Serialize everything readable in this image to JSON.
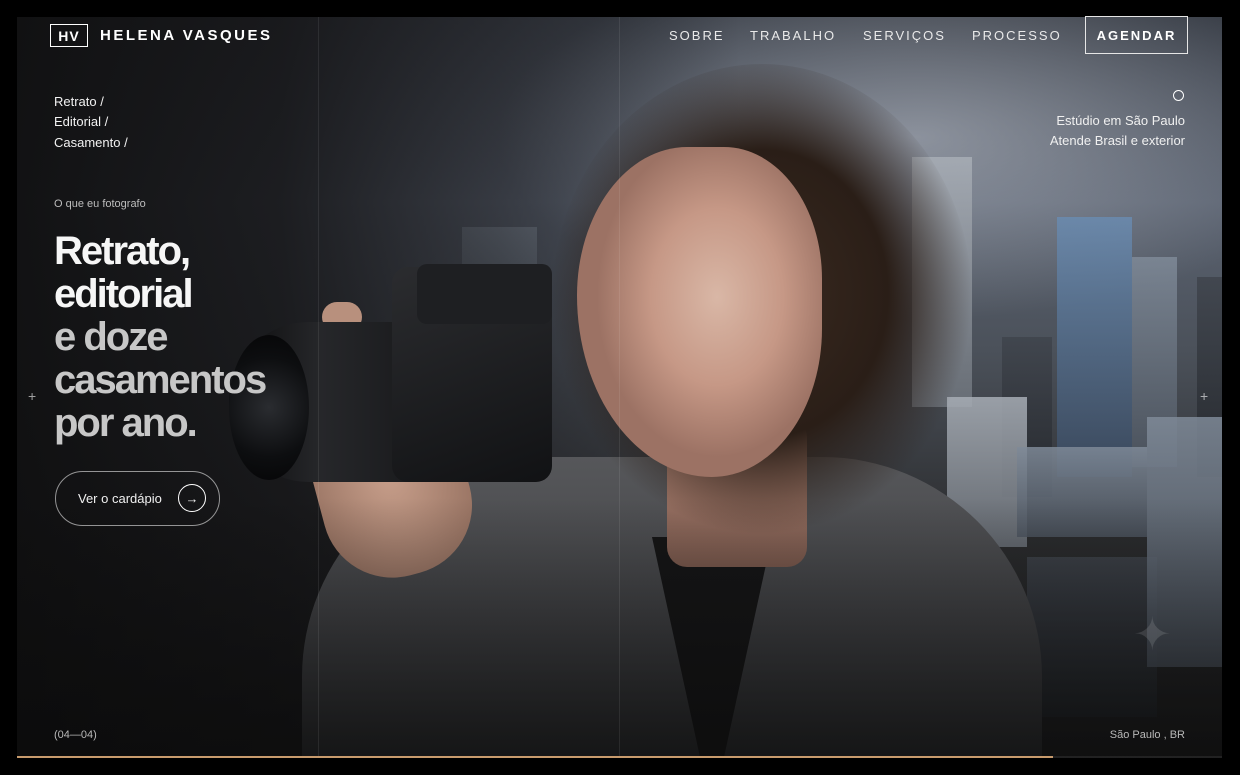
{
  "brand": {
    "logo_mark": "HV",
    "name": "HELENA VASQUES"
  },
  "nav": {
    "links": [
      "SOBRE",
      "TRABALHO",
      "SERVIÇOS",
      "PROCESSO"
    ],
    "cta": "AGENDAR"
  },
  "breadcrumbs": [
    "Retrato /",
    "Editorial /",
    "Casamento /"
  ],
  "hero": {
    "kicker": "O que eu fotografo",
    "headline": [
      "Retrato,",
      "editorial",
      "e doze",
      "casamentos",
      "por ano."
    ],
    "button_label": "Ver o cardápio",
    "button_icon": "arrow-right-icon"
  },
  "studio": {
    "status_icon": "circle-icon",
    "line1": "Estúdio em São Paulo",
    "line2": "Atende Brasil e exterior"
  },
  "footer": {
    "counter": "(04—04)",
    "location": "São Paulo ,  BR"
  },
  "progress": {
    "value": 0.86
  },
  "colors": {
    "accent": "#c89b6d",
    "background": "#000000",
    "text": "#ffffff"
  }
}
